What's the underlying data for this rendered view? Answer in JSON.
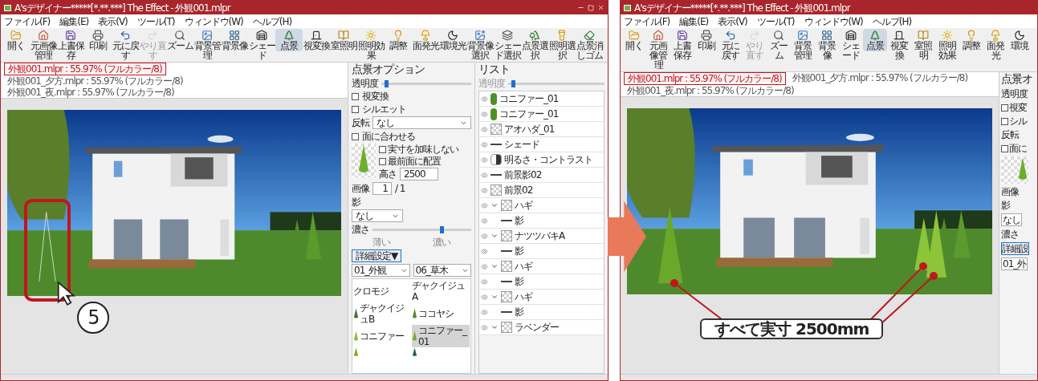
{
  "windows": [
    {
      "title": "A'sデザイナー*****[*.**.***] The Effect - 外観001.mlpr",
      "menu": [
        "ファイル(F)",
        "編集(E)",
        "表示(V)",
        "ツール(T)",
        "ウィンドウ(W)",
        "ヘルプ(H)"
      ],
      "toolbar": [
        {
          "label": "開く",
          "selected": false,
          "disabled": false
        },
        {
          "label": "元画像管理",
          "selected": false,
          "disabled": false
        },
        {
          "label": "上書保存",
          "selected": false,
          "disabled": false
        },
        {
          "label": "印刷",
          "selected": false,
          "disabled": false
        },
        {
          "label": "元に戻す",
          "selected": false,
          "disabled": false
        },
        {
          "label": "やり直す",
          "selected": false,
          "disabled": true
        },
        {
          "label": "ズーム",
          "selected": false,
          "disabled": false
        },
        {
          "label": "背景管理",
          "selected": false,
          "disabled": false
        },
        {
          "label": "背景像",
          "selected": false,
          "disabled": false
        },
        {
          "label": "シェード",
          "selected": false,
          "disabled": false
        },
        {
          "label": "点景",
          "selected": true,
          "disabled": false
        },
        {
          "label": "視変換",
          "selected": false,
          "disabled": false
        },
        {
          "label": "室照明",
          "selected": false,
          "disabled": false
        },
        {
          "label": "照明効果",
          "selected": false,
          "disabled": false
        },
        {
          "label": "調整",
          "selected": false,
          "disabled": false
        },
        {
          "label": "面発光",
          "selected": false,
          "disabled": false
        },
        {
          "label": "環境光",
          "selected": false,
          "disabled": false
        },
        {
          "label": "背景像選択",
          "selected": false,
          "disabled": false
        },
        {
          "label": "シェード選択",
          "selected": false,
          "disabled": false
        },
        {
          "label": "点景選択",
          "selected": false,
          "disabled": false
        },
        {
          "label": "照明選択",
          "selected": false,
          "disabled": false
        },
        {
          "label": "点景消しゴム",
          "selected": false,
          "disabled": false
        }
      ],
      "tabs": [
        {
          "label": "外観001.mlpr : 55.97% (フルカラー/8)",
          "selected": true
        },
        {
          "label": "外観001_夕方.mlpr : 55.97% (フルカラー/8)",
          "selected": false
        },
        {
          "label": "外観001_夜.mlpr : 55.97% (フルカラー/8)",
          "selected": false
        }
      ],
      "scene": {
        "plants_placed": false,
        "highlight": true,
        "step": "5"
      },
      "options": {
        "title": "点景オプション",
        "opacity_label": "透明度",
        "opacity": {
          "level": 0.05
        },
        "checks_top": [
          {
            "label": "視変換",
            "checked": false
          },
          {
            "label": "シルエット",
            "checked": false
          }
        ],
        "flip_label": "反転",
        "flip_value": "なし",
        "fit": {
          "label": "面に合わせる",
          "checked": false
        },
        "checks_side": [
          {
            "label": "実寸を加味しない",
            "checked": false
          },
          {
            "label": "最前面に配置",
            "checked": false
          }
        ],
        "height_label": "高さ",
        "height_value": "2500",
        "image_label": "画像",
        "image_value": "1",
        "image_total": "/ 1",
        "shadow_label": "影",
        "shadow_value": "なし",
        "density_label": "濃さ",
        "density": {
          "level": 0.7
        },
        "density_min": "薄い",
        "density_max": "濃い",
        "detail_button": "詳細設定▼",
        "category": "01_外観",
        "subcategory": "06_草木",
        "gallery": [
          {
            "label": "クロモジ",
            "selected": false
          },
          {
            "label": "ヂャクイジュA",
            "selected": false
          },
          {
            "label": "ヂャクイジュB",
            "selected": false
          },
          {
            "label": "ココヤシ",
            "selected": false
          },
          {
            "label": "コニファー",
            "selected": false
          },
          {
            "label": "コニファー_01",
            "selected": true
          },
          {
            "selected": false
          },
          {
            "selected": false
          }
        ]
      },
      "list": {
        "title": "リスト",
        "opacity_label": "透明度",
        "opacity": {
          "level": 0.05
        },
        "items": [
          {
            "label": "コニファー_01",
            "kind": "tree"
          },
          {
            "label": "コニファー_01",
            "kind": "tree"
          },
          {
            "label": "アオハダ_01",
            "kind": "photo"
          },
          {
            "label": "シェード",
            "kind": "line"
          },
          {
            "label": "明るさ・コントラスト",
            "kind": "adjust"
          },
          {
            "label": "前景影02",
            "kind": "line"
          },
          {
            "label": "前景02",
            "kind": "photo"
          },
          {
            "label": "ハギ",
            "kind": "photo",
            "expanded": true,
            "children": [
              {
                "label": "影",
                "kind": "line"
              }
            ]
          },
          {
            "label": "ナツツバキA",
            "kind": "photo",
            "expanded": true,
            "children": [
              {
                "label": "影",
                "kind": "line"
              }
            ]
          },
          {
            "label": "ハギ",
            "kind": "photo",
            "expanded": true,
            "children": [
              {
                "label": "影",
                "kind": "line"
              }
            ]
          },
          {
            "label": "ハギ",
            "kind": "photo",
            "expanded": true,
            "children": [
              {
                "label": "影",
                "kind": "line"
              }
            ]
          },
          {
            "label": "ラベンダー",
            "kind": "photo",
            "expanded": true
          }
        ]
      }
    },
    {
      "title": "A'sデザイナー*****[*.**.***] The Effect - 外観001.mlpr",
      "menu": [
        "ファイル(F)",
        "編集(E)",
        "表示(V)",
        "ツール(T)",
        "ウィンドウ(W)",
        "ヘルプ(H)"
      ],
      "toolbar": [
        {
          "label": "開く",
          "selected": false,
          "disabled": false
        },
        {
          "label": "元画像管理",
          "selected": false,
          "disabled": false
        },
        {
          "label": "上書保存",
          "selected": false,
          "disabled": false
        },
        {
          "label": "印刷",
          "selected": false,
          "disabled": false
        },
        {
          "label": "元に戻す",
          "selected": false,
          "disabled": false
        },
        {
          "label": "やり直す",
          "selected": false,
          "disabled": true
        },
        {
          "label": "ズーム",
          "selected": false,
          "disabled": false
        },
        {
          "label": "背景管理",
          "selected": false,
          "disabled": false
        },
        {
          "label": "背景像",
          "selected": false,
          "disabled": false
        },
        {
          "label": "シェード",
          "selected": false,
          "disabled": false
        },
        {
          "label": "点景",
          "selected": true,
          "disabled": false
        },
        {
          "label": "視変換",
          "selected": false,
          "disabled": false
        },
        {
          "label": "室照明",
          "selected": false,
          "disabled": false
        },
        {
          "label": "照明効果",
          "selected": false,
          "disabled": false
        },
        {
          "label": "調整",
          "selected": false,
          "disabled": false
        },
        {
          "label": "面発光",
          "selected": false,
          "disabled": false
        },
        {
          "label": "環境",
          "selected": false,
          "disabled": false
        }
      ],
      "tabs": [
        {
          "label": "外観001.mlpr : 55.97% (フルカラー/8)",
          "selected": true
        },
        {
          "label": "外観001_夕方.mlpr : 55.97% (フルカラー/8)",
          "selected": false
        },
        {
          "label": "外観001_夜.mlpr : 55.97% (フルカラー/8)",
          "selected": false
        }
      ],
      "scene": {
        "plants_placed": true,
        "highlight": false,
        "callout": "すべて実寸 2500mm"
      },
      "options_partial": {
        "title": "点景オ",
        "rows": [
          {
            "kind": "text",
            "label": "透明度"
          },
          {
            "kind": "check",
            "label": "視変",
            "checked": false
          },
          {
            "kind": "check",
            "label": "シル",
            "checked": false
          },
          {
            "kind": "text",
            "label": "反転"
          },
          {
            "kind": "check",
            "label": "面に",
            "checked": false
          },
          {
            "kind": "thumb"
          },
          {
            "kind": "text",
            "label": "画像"
          },
          {
            "kind": "text",
            "label": "影"
          },
          {
            "kind": "select",
            "label": "なし"
          },
          {
            "kind": "text",
            "label": "濃さ"
          },
          {
            "kind": "button",
            "label": "詳細設"
          },
          {
            "kind": "select",
            "label": "01_外"
          }
        ]
      }
    }
  ]
}
